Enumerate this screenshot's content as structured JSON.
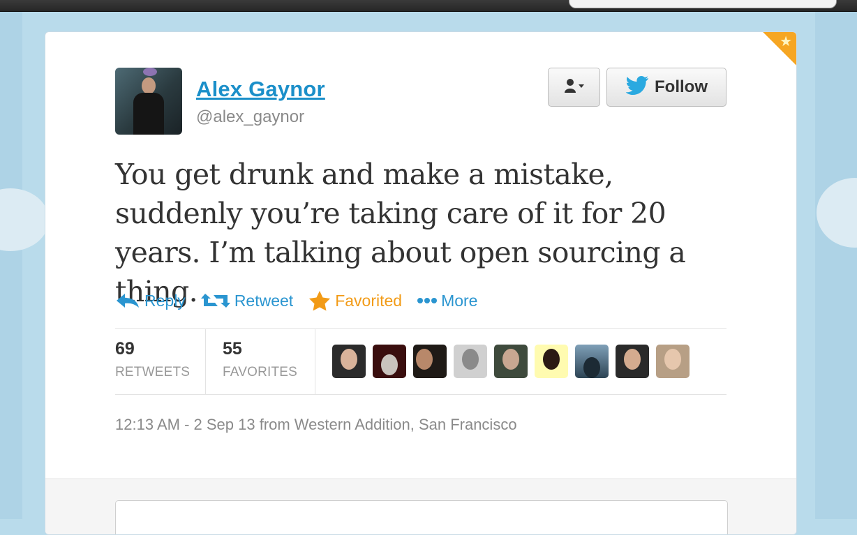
{
  "tweet": {
    "author_name": "Alex Gaynor",
    "author_handle": "@alex_gaynor",
    "text": "You get drunk and make a mistake, suddenly you’re taking care of it for 20 years. I’m talking about open sourcing a thing.",
    "timestamp": "12:13 AM - 2 Sep 13 from Western Addition, San Francisco"
  },
  "buttons": {
    "follow_label": "Follow"
  },
  "actions": {
    "reply": "Reply",
    "retweet": "Retweet",
    "favorited": "Favorited",
    "more": "More"
  },
  "stats": {
    "retweets_count": "69",
    "retweets_label": "RETWEETS",
    "favorites_count": "55",
    "favorites_label": "FAVORITES"
  },
  "colors": {
    "link_blue": "#1b8fc9",
    "favorite_orange": "#f29b17",
    "background": "#b9dbeb"
  }
}
